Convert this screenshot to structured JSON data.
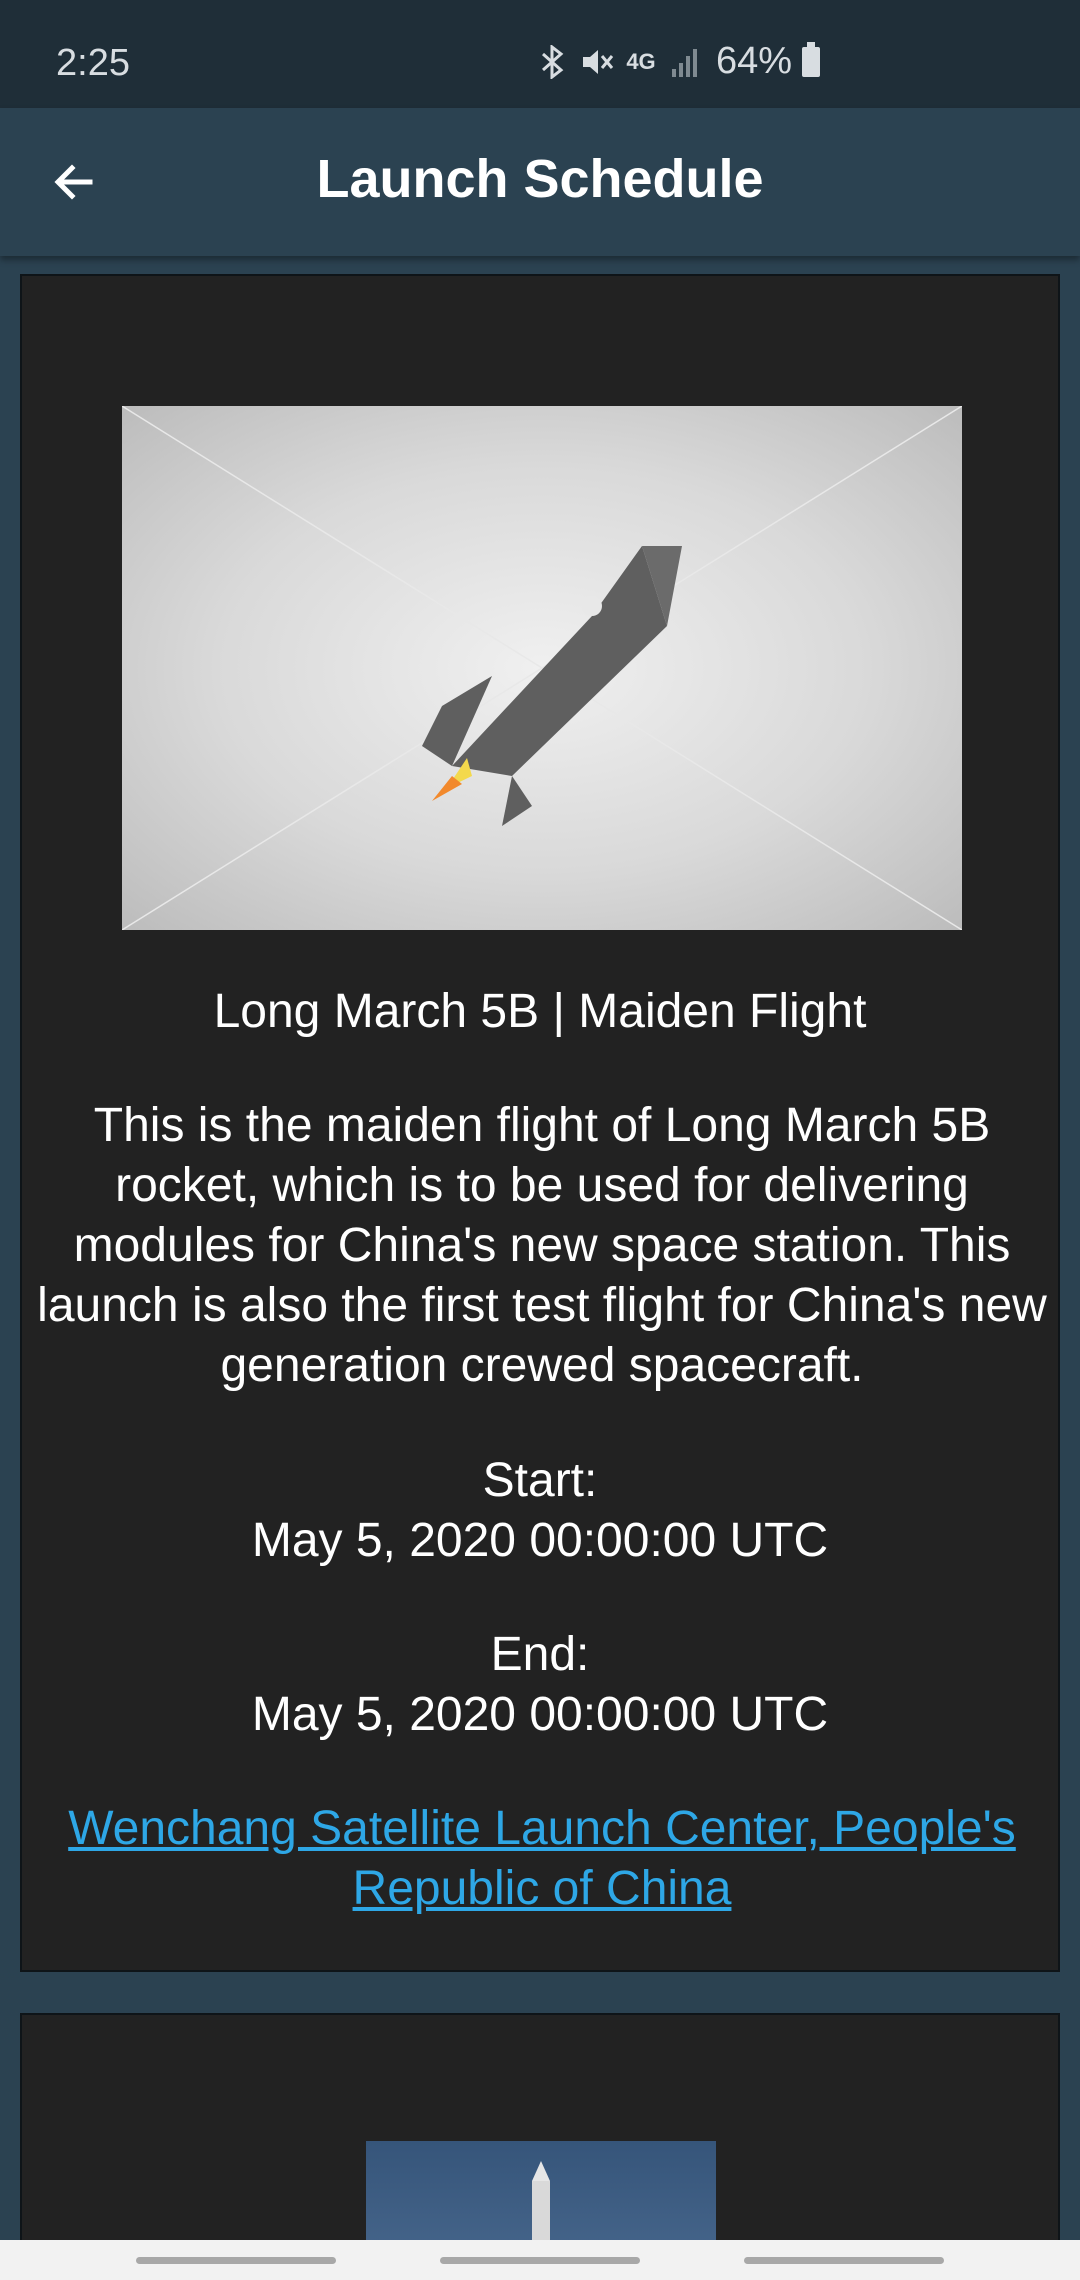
{
  "status_bar": {
    "time": "2:25",
    "battery": "64%",
    "icons": [
      "bluetooth-icon",
      "mute-icon",
      "4g-icon",
      "signal-icon",
      "battery-icon"
    ]
  },
  "app_bar": {
    "title": "Launch Schedule",
    "back_icon": "arrow-left-icon"
  },
  "launches": [
    {
      "image_icon": "rocket-placeholder-icon",
      "name": "Long March 5B | Maiden Flight",
      "description": "This is the maiden flight of Long March 5B rocket, which is to be used for delivering modules for China's new space station. This launch is also the first test flight for China's new generation crewed spacecraft.",
      "start_label": "Start:",
      "start_time": "May 5, 2020 00:00:00 UTC",
      "end_label": "End:",
      "end_time": "May 5, 2020 00:00:00 UTC",
      "location": "Wenchang Satellite Launch Center, People's Republic of China"
    }
  ],
  "colors": {
    "background": "#2b4251",
    "status_bar": "#1f2e38",
    "card": "#222222",
    "link": "#2ea7e6"
  }
}
